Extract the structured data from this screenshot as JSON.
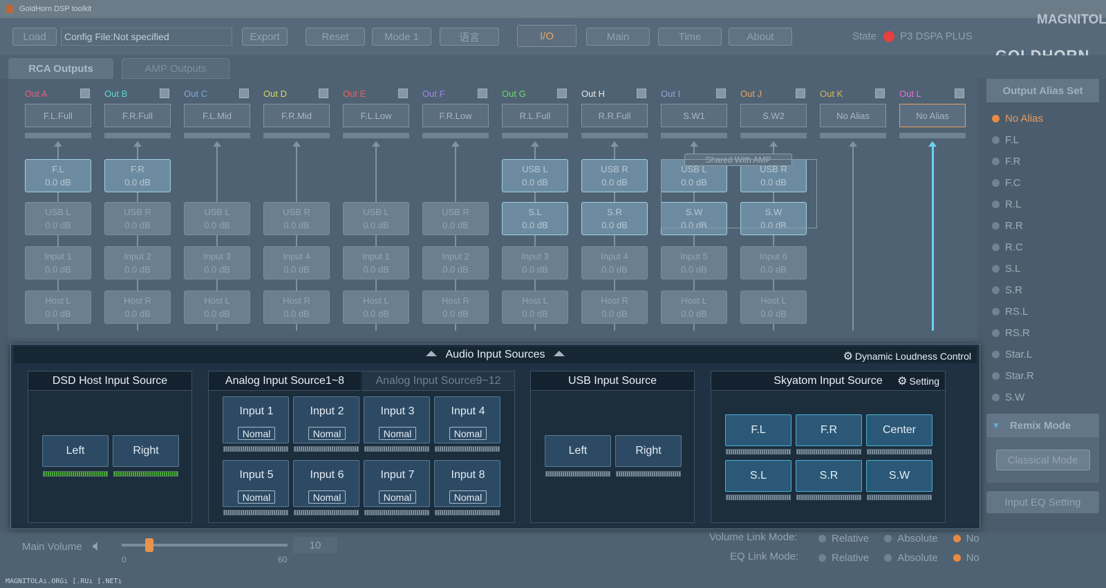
{
  "window": {
    "title": "GoldHorn DSP toolkit"
  },
  "toolbar": {
    "load": "Load",
    "config_file": "Config File:Not specified",
    "export": "Export",
    "reset": "Reset",
    "mode": "Mode 1",
    "lang": "语言",
    "tabs": [
      "I/O",
      "Main",
      "Time",
      "About"
    ],
    "state_label": "State",
    "device": "P3 DSPA PLUS",
    "logo": "GOLDHORN"
  },
  "watermark": {
    "top": "MAGNITOLA",
    "bottom": "MAGNITOLAı.ORGı [.RUı [.NETı"
  },
  "subtabs": [
    "RCA Outputs",
    "AMP Outputs"
  ],
  "shared_label": "Shared With AMP",
  "outputs": [
    {
      "label": "Out A",
      "color": "#e85d7f",
      "alias": "F.L.Full",
      "sources": [
        "F.L|0.0 dB",
        "USB L|0.0 dB",
        "Input 1|0.0 dB",
        "Host L|0.0 dB"
      ]
    },
    {
      "label": "Out B",
      "color": "#5ed6cf",
      "alias": "F.R.Full",
      "sources": [
        "F.R|0.0 dB",
        "USB R|0.0 dB",
        "Input 2|0.0 dB",
        "Host R|0.0 dB"
      ]
    },
    {
      "label": "Out C",
      "color": "#7ea6d6",
      "alias": "F.L.Mid",
      "sources": [
        "",
        "USB L|0.0 dB",
        "Input 3|0.0 dB",
        "Host L|0.0 dB"
      ]
    },
    {
      "label": "Out D",
      "color": "#d6d65e",
      "alias": "F.R.Mid",
      "sources": [
        "",
        "USB R|0.0 dB",
        "Input 4|0.0 dB",
        "Host R|0.0 dB"
      ]
    },
    {
      "label": "Out E",
      "color": "#e8605e",
      "alias": "F.L.Low",
      "sources": [
        "",
        "USB L|0.0 dB",
        "Input 1|0.0 dB",
        "Host L|0.0 dB"
      ]
    },
    {
      "label": "Out F",
      "color": "#9e86e8",
      "alias": "F.R.Low",
      "sources": [
        "",
        "USB R|0.0 dB",
        "Input 2|0.0 dB",
        "Host R|0.0 dB"
      ]
    },
    {
      "label": "Out G",
      "color": "#6ed66e",
      "alias": "R.L.Full",
      "sources": [
        "USB L|0.0 dB",
        "S.L|0.0 dB",
        "Input 3|0.0 dB",
        "Host L|0.0 dB"
      ]
    },
    {
      "label": "Out H",
      "color": "#e8e8e8",
      "alias": "R.R.Full",
      "sources": [
        "USB R|0.0 dB",
        "S.R|0.0 dB",
        "Input 4|0.0 dB",
        "Host R|0.0 dB"
      ]
    },
    {
      "label": "Out I",
      "color": "#8ea6d6",
      "alias": "S.W1",
      "sources": [
        "USB L|0.0 dB",
        "S.W|0.0 dB",
        "Input 5|0.0 dB",
        "Host L|0.0 dB"
      ]
    },
    {
      "label": "Out J",
      "color": "#e8a05e",
      "alias": "S.W2",
      "sources": [
        "USB R|0.0 dB",
        "S.W|0.0 dB",
        "Input 6|0.0 dB",
        "Host L|0.0 dB"
      ]
    },
    {
      "label": "Out K",
      "color": "#d6b65e",
      "alias": "No Alias",
      "sources": [
        "",
        "",
        "",
        ""
      ]
    },
    {
      "label": "Out L",
      "color": "#e86ed6",
      "alias": "No Alias",
      "sources": [
        "",
        "",
        "",
        ""
      ]
    }
  ],
  "alias_set": {
    "title": "Output Alias Set",
    "items": [
      "No Alias",
      "F.L",
      "F.R",
      "F.C",
      "R.L",
      "R.R",
      "R.C",
      "S.L",
      "S.R",
      "RS.L",
      "RS.R",
      "Star.L",
      "Star.R",
      "S.W"
    ],
    "selected": "No Alias"
  },
  "remix": {
    "title": "Remix Mode",
    "button": "Classical Mode",
    "eq_button": "Input EQ Setting"
  },
  "panel": {
    "title": "Audio Input Sources",
    "loudness": "Dynamic Loudness Control",
    "dsd": {
      "title": "DSD Host Input Source",
      "left": "Left",
      "right": "Right"
    },
    "analog": {
      "tab1": "Analog Input Source1~8",
      "tab2": "Analog Input Source9~12",
      "inputs": [
        "Input 1",
        "Input 2",
        "Input 3",
        "Input 4",
        "Input 5",
        "Input 6",
        "Input 7",
        "Input 8"
      ],
      "mode": "Nomal"
    },
    "usb": {
      "title": "USB Input Source",
      "left": "Left",
      "right": "Right"
    },
    "skyatom": {
      "title": "Skyatom Input Source",
      "setting": "Setting",
      "buttons": [
        "F.L",
        "F.R",
        "Center",
        "S.L",
        "S.R",
        "S.W"
      ]
    }
  },
  "bottom": {
    "main_volume": "Main Volume",
    "volume_value": "10",
    "vol_min": "0",
    "vol_max": "60",
    "volume_link": "Volume Link Mode:",
    "eq_link": "EQ Link Mode:",
    "opt_relative": "Relative",
    "opt_absolute": "Absolute",
    "opt_no": "No"
  }
}
